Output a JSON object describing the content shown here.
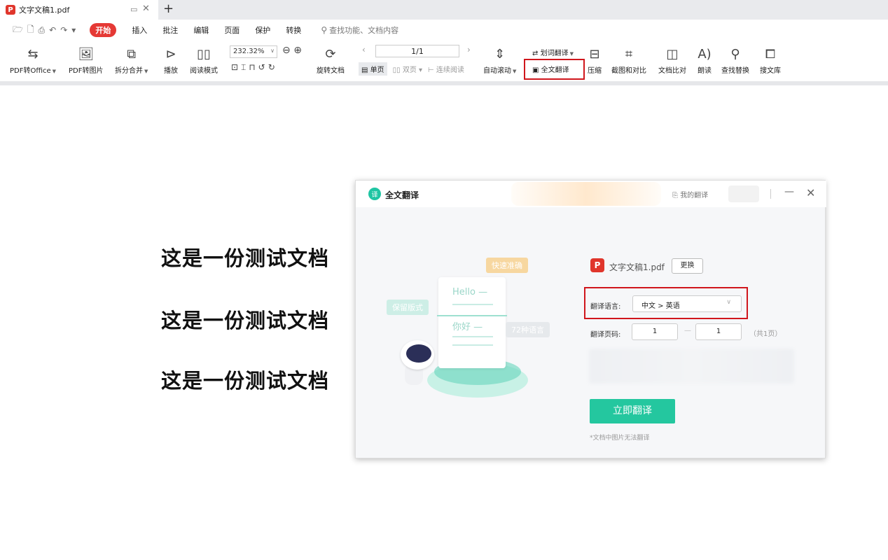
{
  "tab": {
    "logo_glyph": "P",
    "title": "文字文稿1.pdf",
    "pin_glyph": "▭",
    "close_glyph": "✕",
    "add_glyph": "+"
  },
  "quick_access": [
    "🗁",
    "🗋",
    "⎙",
    "↶",
    "↷",
    "▾"
  ],
  "menu": {
    "start": "开始",
    "items": [
      "插入",
      "批注",
      "编辑",
      "页面",
      "保护",
      "转换"
    ],
    "search_placeholder": "查找功能、文档内容"
  },
  "ribbon": {
    "pdf_to_office": "PDF转Office",
    "pdf_to_image": "PDF转图片",
    "split_merge": "拆分合并",
    "play": "播放",
    "read_mode": "阅读模式",
    "zoom": "232.32%",
    "rotate": "旋转文档",
    "page": "1/1",
    "single": "单页",
    "double": "双页",
    "continuous": "连续阅读",
    "auto_scroll": "自动滚动",
    "word_translate": "划词翻译",
    "full_translate": "全文翻译",
    "compress": "压缩",
    "screenshot_compare": "截图和对比",
    "doc_compare": "文档比对",
    "read_aloud": "朗读",
    "find_replace": "查找替换",
    "search_library": "搜文库"
  },
  "document": {
    "lines": [
      "这是一份测试文档",
      "这是一份测试文档",
      "这是一份测试文档"
    ]
  },
  "dialog": {
    "title": "全文翻译",
    "my_translations": "我的翻译",
    "minimize": "—",
    "close": "✕",
    "illustration": {
      "fast": "快速准确",
      "keep_format": "保留版式",
      "languages": "72种语言",
      "hello": "Hello —",
      "nihao": "你好 —"
    },
    "file_name": "文字文稿1.pdf",
    "change_button": "更换",
    "lang_label": "翻译语言:",
    "lang_value": "中文 > 英语",
    "pages_label": "翻译页码:",
    "page_from": "1",
    "page_to": "1",
    "page_dash": "—",
    "page_total": "（共1页）",
    "translate_button": "立即翻译",
    "note": "*文档中图片无法翻译"
  },
  "colors": {
    "accent": "#24c79f",
    "highlight": "#d0161c",
    "brand_red": "#e0362c"
  }
}
